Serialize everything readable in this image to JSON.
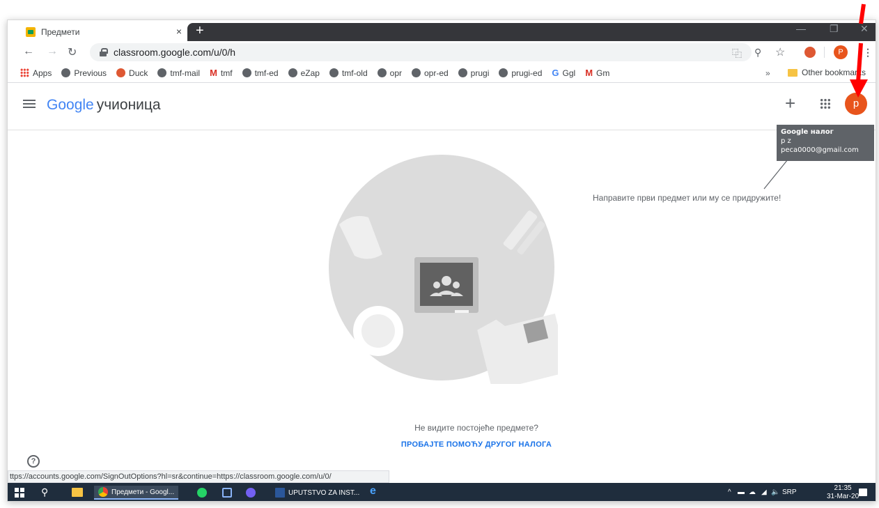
{
  "browser": {
    "tab_title": "Предмети",
    "tab_close": "×",
    "new_tab": "+",
    "url": "classroom.google.com/u/0/h",
    "profile_initial": "P"
  },
  "bookmarks": {
    "items": [
      {
        "label": "Apps",
        "icon": "apps-grid-icon"
      },
      {
        "label": "Previous",
        "icon": "globe-icon"
      },
      {
        "label": "Duck",
        "icon": "duckduckgo-icon"
      },
      {
        "label": "tmf-mail",
        "icon": "globe-icon"
      },
      {
        "label": "tmf",
        "icon": "gmail-icon"
      },
      {
        "label": "tmf-ed",
        "icon": "globe-icon"
      },
      {
        "label": "eZap",
        "icon": "globe-icon"
      },
      {
        "label": "tmf-old",
        "icon": "globe-icon"
      },
      {
        "label": "opr",
        "icon": "globe-icon"
      },
      {
        "label": "opr-ed",
        "icon": "globe-icon"
      },
      {
        "label": "prugi",
        "icon": "globe-icon"
      },
      {
        "label": "prugi-ed",
        "icon": "globe-icon"
      },
      {
        "label": "Ggl",
        "icon": "google-g-icon"
      },
      {
        "label": "Gm",
        "icon": "gmail-icon"
      }
    ],
    "more": "»",
    "other": "Other bookmarks"
  },
  "app": {
    "logo_google": "Google",
    "logo_product": "учионица",
    "avatar_initial": "p"
  },
  "tooltip": {
    "title": "Google налог",
    "name": "p z",
    "email": "peca0000@gmail.com"
  },
  "main": {
    "invite_text": "Направите први предмет или му се придружите!",
    "no_classes": "Не видите постојеће предмете?",
    "try_other": "ПРОБАЈТЕ ПОМОЋУ ДРУГОГ НАЛОГА"
  },
  "status_url": "ttps://accounts.google.com/SignOutOptions?hl=sr&continue=https://classroom.google.com/u/0/",
  "taskbar": {
    "chrome_label": "Предмети - Googl...",
    "word_label": "UPUTSTVO ZA INST...",
    "lang": "SRP",
    "time": "21:35",
    "date": "31-Mar-20"
  },
  "colors": {
    "accent": "#1a73e8",
    "avatar": "#e8541c",
    "arrow": "#ff0000"
  }
}
